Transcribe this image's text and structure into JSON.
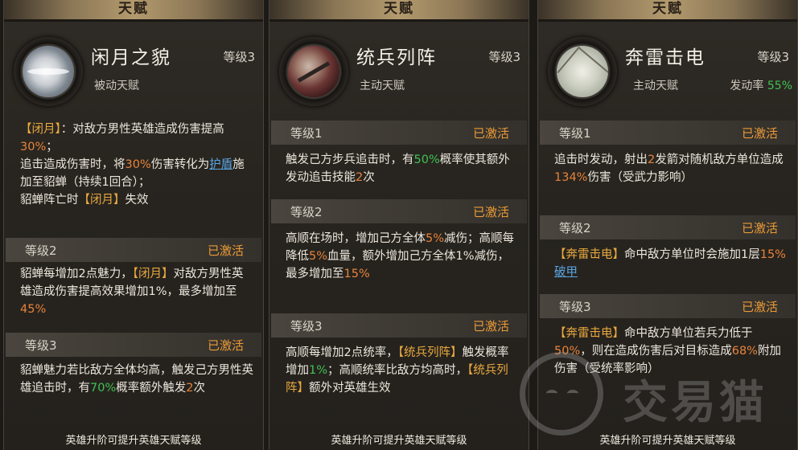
{
  "panels": [
    {
      "header": "天赋",
      "name": "闲月之貌",
      "level": "等级3",
      "type": "被动天赋",
      "para0": [
        "【闭月】",
        "：对敌方男性英雄造成伤害提高",
        "30%",
        "；"
      ],
      "para0b": [
        "追击造成伤害时，将",
        "30%",
        "伤害转化为",
        "护盾",
        "施加至貂蝉（持续1回合）；"
      ],
      "para0c": [
        "貂蝉阵亡时",
        "【闭月】",
        "失效"
      ],
      "lv2": {
        "label": "等级2",
        "status": "已激活"
      },
      "para1": [
        "貂蝉每增加2点魅力，",
        "【闭月】",
        "对敌方男性英雄造成伤害提高效果增加1%，最多增加至",
        "45%"
      ],
      "lv3": {
        "label": "等级3",
        "status": "已激活"
      },
      "para2": [
        "貂蝉魅力若比敌方全体均高，触发己方男性英雄追击时，有",
        "70%",
        "概率额外触发",
        "2",
        "次"
      ],
      "footer": "英雄升阶可提升英雄天赋等级"
    },
    {
      "header": "天赋",
      "name": "统兵列阵",
      "level": "等级3",
      "type": "主动天赋",
      "lv1": {
        "label": "等级1",
        "status": "已激活"
      },
      "para0": [
        "触发己方步兵追击时，有",
        "50%",
        "概率使其额外发动追击技能",
        "2",
        "次"
      ],
      "lv2": {
        "label": "等级2",
        "status": "已激活"
      },
      "para1": [
        "高顺在场时，增加己方全体",
        "5%",
        "减伤；高顺每降低",
        "5%",
        "血量，额外增加己方全体1%减伤，最多增加至",
        "15%"
      ],
      "lv3": {
        "label": "等级3",
        "status": "已激活"
      },
      "para2": [
        "高顺每增加2点统率，",
        "【统兵列阵】",
        "触发概率增加",
        "1%",
        "；高顺统率比敌方均高时，",
        "【统兵列阵】",
        "额外对英雄生效"
      ],
      "footer": "英雄升阶可提升英雄天赋等级"
    },
    {
      "header": "天赋",
      "name": "奔雷击电",
      "level": "等级3",
      "type": "主动天赋",
      "rate_label": "发动率",
      "rate_value": "55%",
      "lv1": {
        "label": "等级1",
        "status": "已激活"
      },
      "para0": [
        "追击时发动，射出",
        "2",
        "发箭对随机敌方单位造成",
        "134%",
        "伤害（受武力影响）"
      ],
      "lv2": {
        "label": "等级2",
        "status": "已激活"
      },
      "para1": [
        "【奔雷击电】",
        "命中敌方单位时会施加1层",
        "15%",
        "破甲"
      ],
      "lv3": {
        "label": "等级3",
        "status": "已激活"
      },
      "para2": [
        "【奔雷击电】",
        "命中敌方单位若兵力低于",
        "50%",
        "，则在造成伤害后对目标造成",
        "68%",
        "附加伤害（受统率影响）"
      ],
      "footer": "英雄升阶可提升英雄天赋等级"
    }
  ],
  "watermark": "交易猫"
}
